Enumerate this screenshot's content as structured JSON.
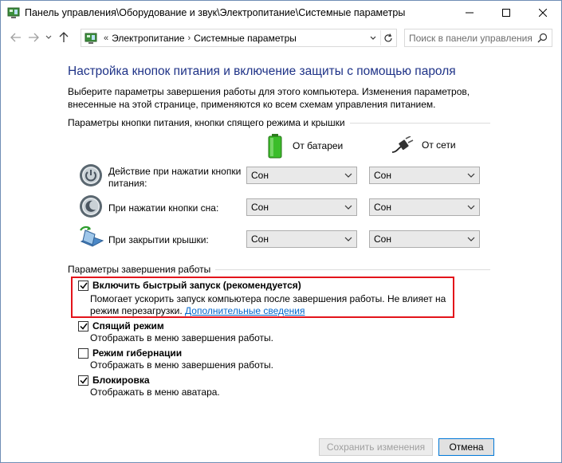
{
  "window": {
    "title": "Панель управления\\Оборудование и звук\\Электропитание\\Системные параметры"
  },
  "address": {
    "overflow": "«",
    "crumbs": [
      "Электропитание",
      "Системные параметры"
    ],
    "search_placeholder": "Поиск в панели управления"
  },
  "page": {
    "heading": "Настройка кнопок питания и включение защиты с помощью пароля",
    "description": "Выберите параметры завершения работы для этого компьютера. Изменения параметров, внесенные на этой странице, применяются ко всем схемам управления питанием."
  },
  "power_buttons": {
    "group_title": "Параметры кнопки питания, кнопки спящего режима и крышки",
    "col_battery": "От батареи",
    "col_ac": "От сети",
    "rows": [
      {
        "label": "Действие при нажатии кнопки питания:",
        "battery": "Сон",
        "ac": "Сон",
        "icon": "power-button-icon"
      },
      {
        "label": "При нажатии кнопки сна:",
        "battery": "Сон",
        "ac": "Сон",
        "icon": "sleep-button-icon"
      },
      {
        "label": "При закрытии крышки:",
        "battery": "Сон",
        "ac": "Сон",
        "icon": "laptop-lid-icon"
      }
    ]
  },
  "shutdown": {
    "group_title": "Параметры завершения работы",
    "options": [
      {
        "label": "Включить быстрый запуск (рекомендуется)",
        "desc": "Помогает ускорить запуск компьютера после завершения работы. Не влияет на режим перезагрузки.",
        "link": "Дополнительные сведения",
        "checked": true
      },
      {
        "label": "Спящий режим",
        "desc": "Отображать в меню завершения работы.",
        "checked": true
      },
      {
        "label": "Режим гибернации",
        "desc": "Отображать в меню завершения работы.",
        "checked": false
      },
      {
        "label": "Блокировка",
        "desc": "Отображать в меню аватара.",
        "checked": true
      }
    ]
  },
  "footer": {
    "save": "Сохранить изменения",
    "cancel": "Отмена"
  },
  "colors": {
    "heading": "#1e3287",
    "link": "#0066cc",
    "highlight": "#e3141b",
    "battery": "#3bbd2a"
  }
}
